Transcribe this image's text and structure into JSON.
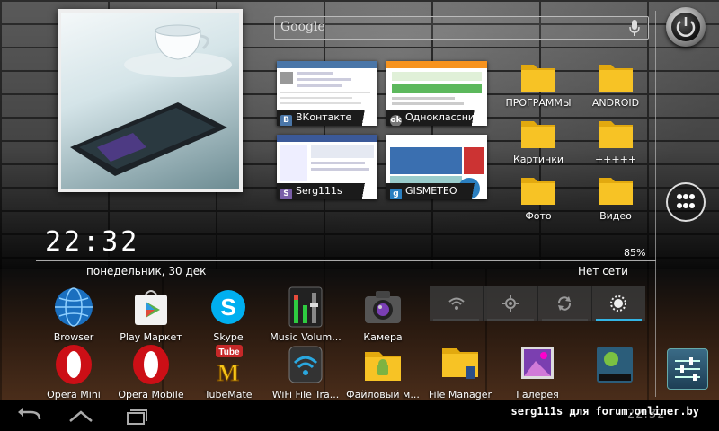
{
  "search": {
    "logo": "Google"
  },
  "recents": [
    {
      "label": "ВКонтакте",
      "icon": "В"
    },
    {
      "label": "Одноклассни...",
      "icon": "ok"
    },
    {
      "label": "Serg111s",
      "icon": "S"
    },
    {
      "label": "GISMETEO",
      "icon": "g"
    }
  ],
  "folders": [
    {
      "label": "ПРОГРАММЫ"
    },
    {
      "label": "ANDROID"
    },
    {
      "label": "Картинки"
    },
    {
      "label": "+++++"
    },
    {
      "label": "Фото"
    },
    {
      "label": "Видео"
    }
  ],
  "clock": {
    "time": "22:32",
    "date": "понедельник, 30 дек",
    "battery": "85%",
    "network": "Нет сети"
  },
  "apps_row1": [
    {
      "label": "Browser",
      "icon": "globe-icon"
    },
    {
      "label": "Play Маркет",
      "icon": "play-store-icon"
    },
    {
      "label": "Skype",
      "icon": "skype-icon"
    },
    {
      "label": "Music Volum...",
      "icon": "equalizer-icon"
    },
    {
      "label": "Камера",
      "icon": "camera-icon"
    }
  ],
  "apps_row2": [
    {
      "label": "Opera Mini",
      "icon": "opera-icon"
    },
    {
      "label": "Opera Mobile",
      "icon": "opera-icon"
    },
    {
      "label": "TubeMate",
      "icon": "tubemate-icon",
      "badge": "Tube"
    },
    {
      "label": "WiFi File Tra...",
      "icon": "wifi-icon"
    },
    {
      "label": "Файловый м...",
      "icon": "folder-android-icon"
    },
    {
      "label": "File Manager",
      "icon": "folder-icon"
    },
    {
      "label": "Галерея",
      "icon": "gallery-icon"
    },
    {
      "label": "",
      "icon": "storage-icon"
    }
  ],
  "status": {
    "clock": "22:32",
    "watermark": "serg111s для forum.onliner.by"
  },
  "colors": {
    "accent": "#33b5e5",
    "folder": "#f7c325"
  }
}
